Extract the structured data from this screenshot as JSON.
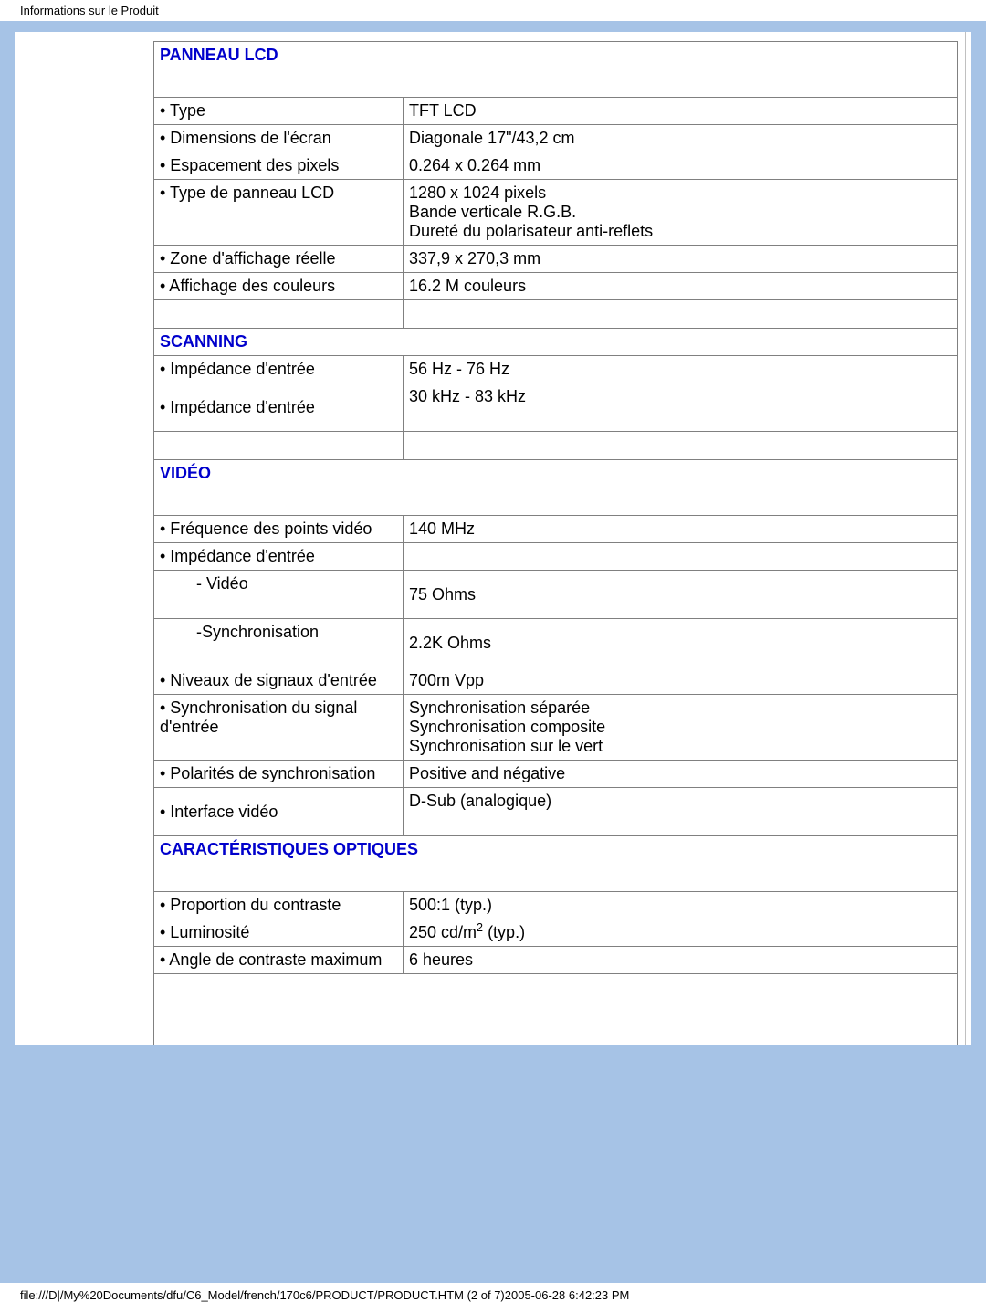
{
  "header": "Informations sur le Produit",
  "footer": "file:///D|/My%20Documents/dfu/C6_Model/french/170c6/PRODUCT/PRODUCT.HTM (2 of 7)2005-06-28 6:42:23 PM",
  "sections": {
    "lcd": {
      "title": "Panneau LCD",
      "rows": {
        "type_label": "• Type",
        "type_value": "TFT LCD",
        "dim_label": "• Dimensions de l'écran",
        "dim_value": "Diagonale 17\"/43,2 cm",
        "pitch_label": "•  Espacement des pixels",
        "pitch_value": "0.264 x 0.264 mm",
        "panel_label": "• Type de panneau LCD",
        "panel_value_l1": "1280 x 1024 pixels",
        "panel_value_l2": "Bande verticale R.G.B.",
        "panel_value_l3": "Dureté du polarisateur anti-reflets",
        "area_label": "• Zone d'affichage réelle",
        "area_value": "337,9 x 270,3 mm",
        "colors_label": "• Affichage des couleurs",
        "colors_value": "16.2 M couleurs"
      }
    },
    "scanning": {
      "title": "Scanning",
      "rows": {
        "imp1_label": "• Impédance d'entrée",
        "imp1_value": "56 Hz - 76 Hz",
        "imp2_label": "• Impédance d'entrée",
        "imp2_value": "30 kHz - 83 kHz"
      }
    },
    "video": {
      "title": "Vidéo",
      "rows": {
        "dotrate_label": "• Fréquence des points vidéo",
        "dotrate_value": "140 MHz",
        "imp_label": "• Impédance d'entrée",
        "vid_label": "- Vidéo",
        "vid_value": "75 Ohms",
        "sync_label": "-Synchronisation",
        "sync_value": "2.2K Ohms",
        "levels_label": "• Niveaux de signaux d'entrée",
        "levels_value": "700m Vpp",
        "sig_label_l1": "• Synchronisation du signal",
        "sig_label_l2": "d'entrée",
        "sig_value_l1": "Synchronisation séparée",
        "sig_value_l2": "Synchronisation composite",
        "sig_value_l3": "Synchronisation sur le vert",
        "pol_label": "• Polarités de synchronisation",
        "pol_value": "Positive and négative",
        "iface_label": "• Interface vidéo",
        "iface_value": "D-Sub (analogique)"
      }
    },
    "optic": {
      "title": "Caractéristiques optiques",
      "rows": {
        "contrast_label": "• Proportion du contraste",
        "contrast_value": "500:1 (typ.)",
        "bright_label": "• Luminosité",
        "bright_value_pre": "250 cd/m",
        "bright_value_sup": "2",
        "bright_value_post": " (typ.)",
        "angle_label": "• Angle de contraste maximum",
        "angle_value": "6 heures"
      }
    }
  }
}
